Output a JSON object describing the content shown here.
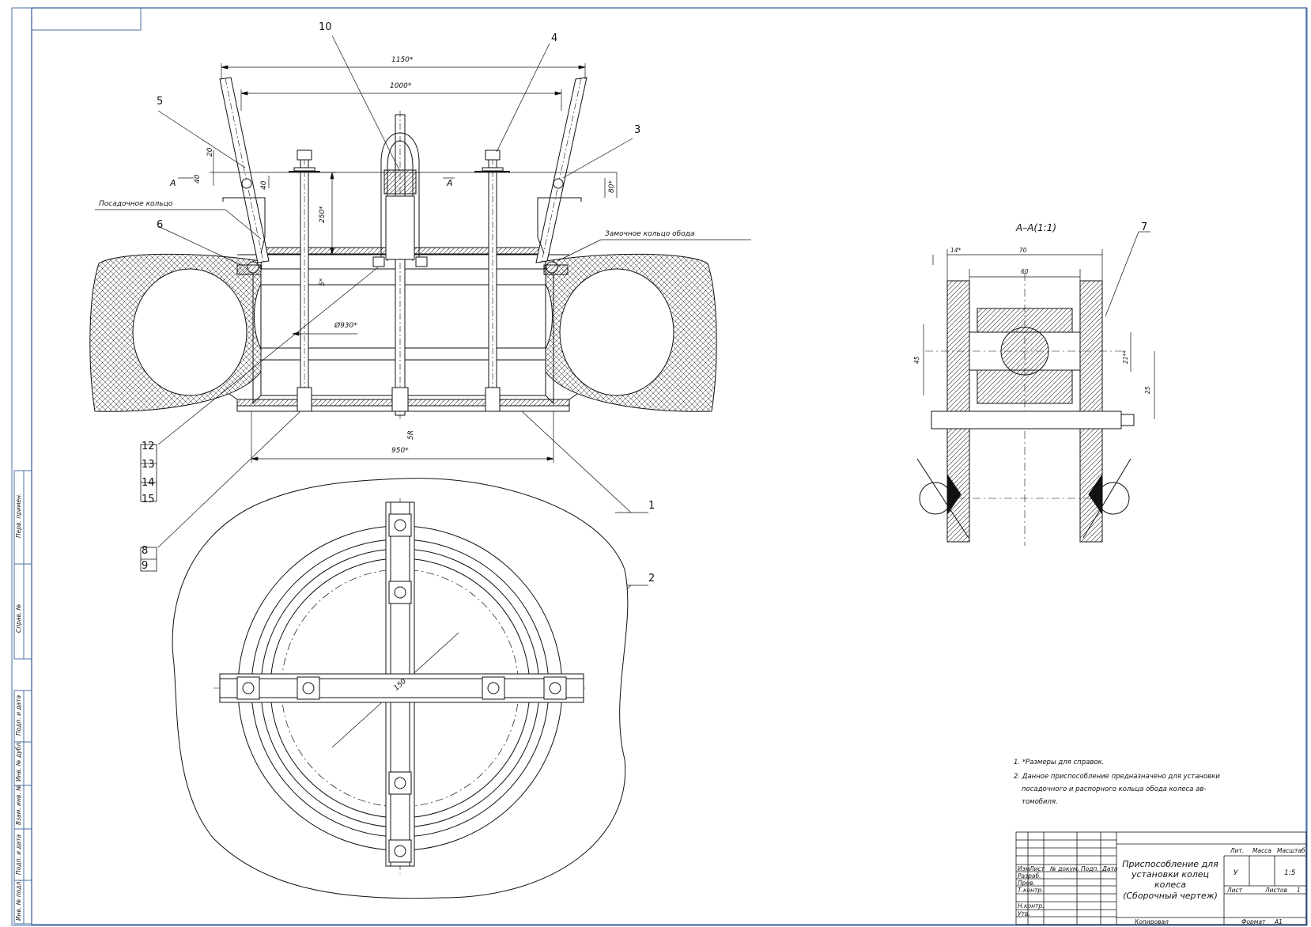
{
  "drawing": {
    "section_title": "А–А(1:1)",
    "section_mark": "А",
    "callouts": {
      "p10": "10",
      "p4": "4",
      "p5": "5",
      "p3": "3",
      "p6": "6",
      "p7": "7",
      "p12": "12",
      "p13": "13",
      "p14": "14",
      "p15": "15",
      "p8": "8",
      "p9": "9",
      "p1": "1",
      "p2": "2"
    },
    "labels": {
      "seat_ring": "Посадочное кольцо",
      "lock_ring": "Замочное кольцо обода"
    },
    "dimensions": {
      "d1150": "1150*",
      "d1000": "1000*",
      "d950": "950*",
      "d250": "250*",
      "d80": "80*",
      "d20": "20",
      "d40a": "40",
      "d40b": "40",
      "d5": "5*",
      "d930": "Ø930*",
      "d5r": "5R",
      "d150": "150",
      "d14a": "14*",
      "d70": "70",
      "d60": "60",
      "d45": "45",
      "d21": "21**",
      "d25": "25"
    }
  },
  "notes": [
    "1. *Размеры для справок.",
    "2. Данное приспособление предназначено для установки",
    "посадочного и распорного кольца обода колеса ав-",
    "томобиля."
  ],
  "title_block": {
    "title_lines": [
      "Приспособление для",
      "установки колец колеса",
      "(Сборочный чертеж)"
    ],
    "col_headers": [
      "Изм",
      "Лист",
      "№ докум.",
      "Подп.",
      "Дата"
    ],
    "row_labels": [
      "Разраб.",
      "Пров.",
      "Т.контр.",
      "Н.контр.",
      "Утв."
    ],
    "lit_label": "Лит.",
    "mass_label": "Масса",
    "scale_label": "Масштаб",
    "lit_value": "У",
    "scale_value": "1:5",
    "sheet_label": "Лист",
    "sheets_label": "Листов",
    "sheets_value": "1",
    "copied_label": "Копировал",
    "format_label": "Формат",
    "format_value": "А1"
  },
  "side_stamp": [
    "Перв. примен.",
    "Справ. №",
    "Подп. и дата",
    "Инв. № дубл.",
    "Взам. инв. №",
    "Подп. и дата",
    "Инв. № подл."
  ]
}
